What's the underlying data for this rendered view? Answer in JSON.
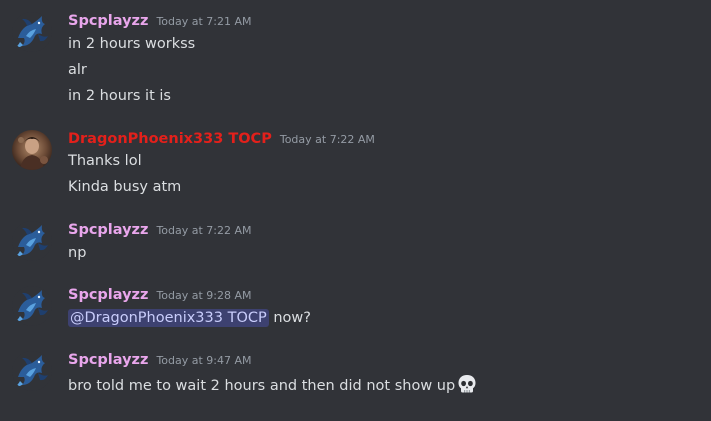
{
  "colors": {
    "background": "#313338",
    "text": "#dbdee1",
    "timestamp": "#949ba4",
    "username_spc": "#e9a6ec",
    "username_dragon": "#e3201b",
    "mention_bg": "#3c4270",
    "mention_text": "#c9cdfb"
  },
  "messages": [
    {
      "author": "Spcplayzz",
      "timestamp": "Today at 7:21 AM",
      "avatar_icon": "blue-dragon-avatar-icon",
      "lines": [
        "in 2 hours workss",
        "alr",
        "in 2 hours it is"
      ]
    },
    {
      "author": "DragonPhoenix333 TOCP",
      "timestamp": "Today at 7:22 AM",
      "avatar_icon": "photo-avatar-icon",
      "lines": [
        "Thanks lol",
        "Kinda busy atm"
      ]
    },
    {
      "author": "Spcplayzz",
      "timestamp": "Today at 7:22 AM",
      "avatar_icon": "blue-dragon-avatar-icon",
      "lines": [
        "np"
      ]
    },
    {
      "author": "Spcplayzz",
      "timestamp": "Today at 9:28 AM",
      "avatar_icon": "blue-dragon-avatar-icon",
      "mention": "@DragonPhoenix333 TOCP",
      "lines": [
        " now?"
      ]
    },
    {
      "author": "Spcplayzz",
      "timestamp": "Today at 9:47 AM",
      "avatar_icon": "blue-dragon-avatar-icon",
      "lines": [
        "bro told me to wait 2 hours and then did not show up"
      ],
      "emoji": "skull-emoji-icon"
    }
  ]
}
